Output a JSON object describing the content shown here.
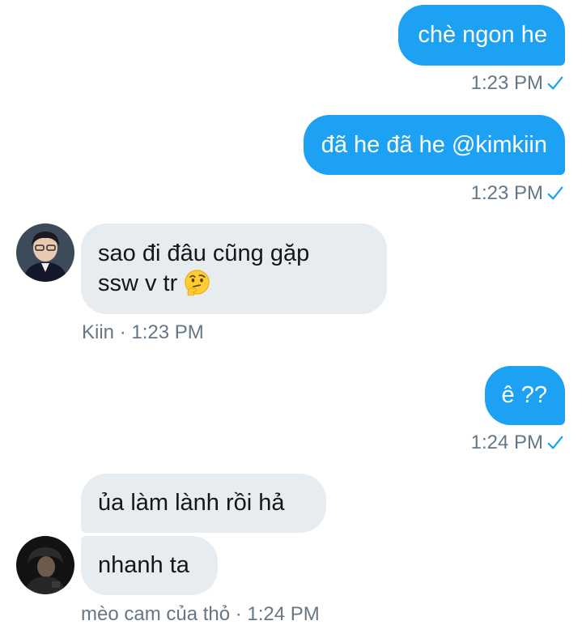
{
  "messages": {
    "m1": {
      "text": "chè ngon he",
      "time": "1:23 PM"
    },
    "m2": {
      "text": "đã he đã he @kimkiin",
      "time": "1:23 PM"
    },
    "m3": {
      "line1": "sao đi đâu cũng gặp",
      "line2": "ssw v tr",
      "emoji": "thinking-face-emoji",
      "meta": "Kiin · 1:23 PM"
    },
    "m4": {
      "text": "ê ??",
      "time": "1:24 PM"
    },
    "m5": {
      "text": "ủa làm lành rồi hả"
    },
    "m6": {
      "text": "nhanh ta",
      "meta": "mèo cam của thỏ · 1:24 PM"
    }
  },
  "icons": {
    "read_check": "checkmark-icon",
    "avatar_kiin": "avatar-kiin",
    "avatar_meo": "avatar-meo-cam"
  },
  "colors": {
    "outgoing_bubble": "#1da1f2",
    "incoming_bubble": "#e6ecf0",
    "meta_text": "#657786",
    "check": "#1da1f2"
  }
}
